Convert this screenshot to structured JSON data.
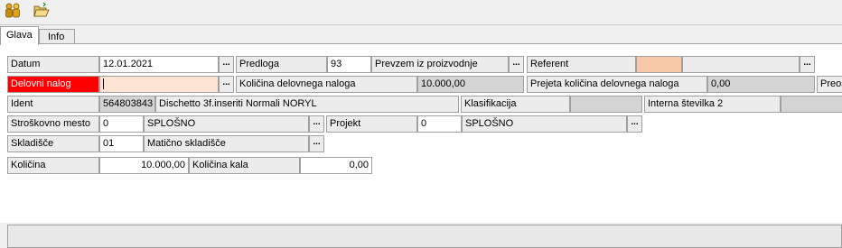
{
  "toolbar": {
    "icon1": "people-icon",
    "icon2": "open-folder-icon"
  },
  "tabs": [
    "Glava",
    "Info"
  ],
  "fields": {
    "datum_label": "Datum",
    "datum_value": "12.01.2021",
    "predloga_label": "Predloga",
    "predloga_value": "93",
    "prevzem_label": "Prevzem iz proizvodnje",
    "referent_label": "Referent",
    "delovni_nalog_label": "Delovni nalog",
    "delovni_nalog_value": "",
    "kolicina_dn_label": "Količina delovnega naloga",
    "kolicina_dn_value": "10.000,00",
    "prejeta_label": "Prejeta količina delovnega naloga",
    "prejeta_value": "0,00",
    "preos_label": "Preos",
    "ident_label": "Ident",
    "ident_code": "564803843",
    "ident_name": "Dischetto 3f.inseriti Normali NORYL",
    "klasifikacija_label": "Klasifikacija",
    "interna_label": "Interna številka 2",
    "stroskovno_label": "Stroškovno mesto",
    "stroskovno_code": "0",
    "stroskovno_name": "SPLOŠNO",
    "projekt_label": "Projekt",
    "projekt_code": "0",
    "projekt_name": "SPLOŠNO",
    "skladisce_label": "Skladišče",
    "skladisce_code": "01",
    "skladisce_name": "Matično skladišče",
    "kolicina_label": "Količina",
    "kolicina_value": "10.000,00",
    "kolicina_kala_label": "Količina kala",
    "kolicina_kala_value": "0,00"
  },
  "browse_label": "...",
  "colors": {
    "required": "#ff0000",
    "highlight": "#f9c8a8",
    "readonly": "#d4d4d4"
  }
}
